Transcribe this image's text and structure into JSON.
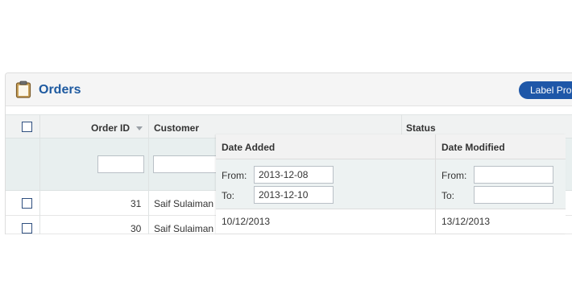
{
  "panel": {
    "title": "Orders",
    "label_button": "Label Pro"
  },
  "grid": {
    "headers": {
      "order_id": "Order ID",
      "customer": "Customer",
      "status": "Status"
    },
    "filters": {
      "order_id": "",
      "customer": ""
    },
    "rows": [
      {
        "order_id": "31",
        "customer": "Saif Sulaiman"
      },
      {
        "order_id": "30",
        "customer": "Saif Sulaiman"
      }
    ]
  },
  "overlay": {
    "headers": {
      "date_added": "Date Added",
      "date_modified": "Date Modified"
    },
    "filters": {
      "from_label": "From:",
      "to_label": "To:",
      "date_added_from": "2013-12-08",
      "date_added_to": "2013-12-10",
      "date_modified_from": "",
      "date_modified_to": ""
    },
    "row": {
      "date_added": "10/12/2013",
      "date_modified": "13/12/2013"
    }
  },
  "colors": {
    "title_blue": "#1e5aa0",
    "button_blue": "#1e57a8",
    "filter_row_bg": "#e8efef"
  },
  "icons": {
    "panel_icon": "clipboard-icon",
    "sort_icon": "sort-desc-icon"
  }
}
